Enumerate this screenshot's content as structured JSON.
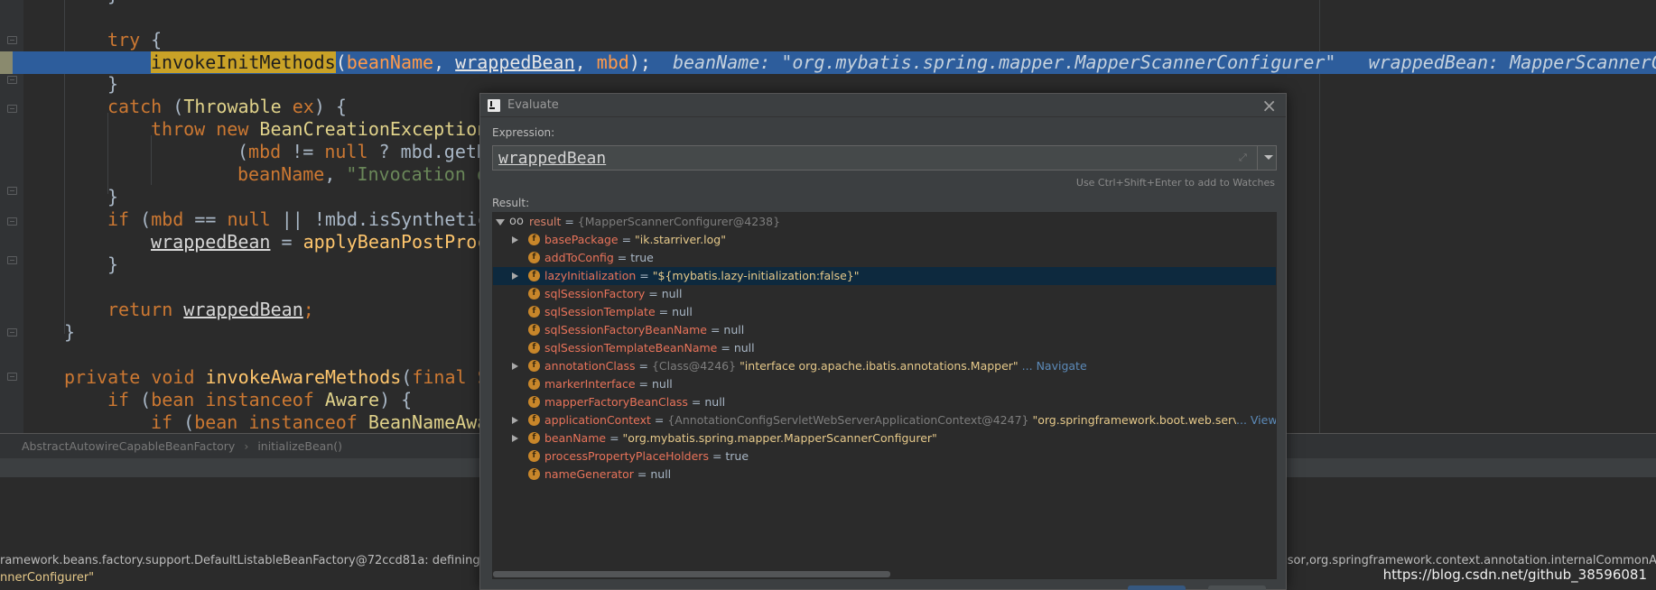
{
  "editor": {
    "lines": {
      "l0": "}",
      "l1_kw": "try",
      "l1_brace": " {",
      "l2_call": "invokeInitMethods",
      "l2_p1": "beanName",
      "l2_p2": "wrappedBean",
      "l2_p3": "mbd",
      "l2_inline": "beanName: \"org.mybatis.spring.mapper.MapperScannerConfigurer\"   wrappedBean: MapperScannerCo",
      "l3": "}",
      "l4_kw": "catch",
      "l4_cls": "Throwable",
      "l4_var": "ex",
      "l5_kw": "throw new",
      "l5_cls": "BeanCreationException",
      "l6_a": "mbd",
      "l6_b": "!= ",
      "l6_kw": "null",
      "l6_c": " ? ",
      "l6_d": "mbd.getR",
      "l7_a": "beanName",
      "l7_str": "\"Invocation o",
      "l8": "}",
      "l9_kw": "if",
      "l9_a": "mbd",
      "l9_kw2": "null",
      "l9_b": "!mbd.isSynthetic",
      "l10_a": "wrappedBean",
      "l10_fn": "applyBeanPostProc",
      "l11": "}",
      "l12_kw": "return",
      "l12_var": "wrappedBean",
      "l13": "}",
      "l14_kw": "private void",
      "l14_fn": "invokeAwareMethods",
      "l14_kw2": "final S",
      "l15_kw": "if",
      "l15_a": "bean",
      "l15_kw2": "instanceof",
      "l15_cls": "Aware",
      "l16_kw": "if",
      "l16_a": "bean",
      "l16_kw2": "instanceof",
      "l16_cls": "BeanNameAwa"
    }
  },
  "breadcrumb": {
    "class_name": "AbstractAutowireCapableBeanFactory",
    "separator": "›",
    "method": "initializeBean()"
  },
  "console": {
    "line1_left": "ramework.beans.factory.support.DefaultListableBeanFactory@72ccd81a: defining beans [org",
    "line1_right": "essor,org.springframework.context.annotation.internalCommonAnnotat",
    "line2": "nnerConfigurer\""
  },
  "dialog": {
    "title": "Evaluate",
    "close_glyph": "×",
    "expression_label": "Expression:",
    "expression_value": "wrappedBean",
    "hint": "Use Ctrl+Shift+Enter to add to Watches",
    "result_label": "Result:",
    "root": {
      "name": "result",
      "eq": " = ",
      "value": "{MapperScannerConfigurer@4238}"
    },
    "fields": [
      {
        "name": "basePackage",
        "eq": " = ",
        "value": "\"ik.starriver.log\""
      },
      {
        "name": "addToConfig",
        "eq": " = ",
        "value": "true"
      },
      {
        "name": "lazyInitialization",
        "eq": " = ",
        "value": "\"${mybatis.lazy-initialization:false}\""
      },
      {
        "name": "sqlSessionFactory",
        "eq": " = ",
        "value": "null"
      },
      {
        "name": "sqlSessionTemplate",
        "eq": " = ",
        "value": "null"
      },
      {
        "name": "sqlSessionFactoryBeanName",
        "eq": " = ",
        "value": "null"
      },
      {
        "name": "sqlSessionTemplateBeanName",
        "eq": " = ",
        "value": "null"
      },
      {
        "name": "annotationClass",
        "eq": " = ",
        "obj": "{Class@4246}",
        "value": "\"interface org.apache.ibatis.annotations.Mapper\"",
        "link": "... Navigate"
      },
      {
        "name": "markerInterface",
        "eq": " = ",
        "value": "null"
      },
      {
        "name": "mapperFactoryBeanClass",
        "eq": " = ",
        "value": "null"
      },
      {
        "name": "applicationContext",
        "eq": " = ",
        "obj": "{AnnotationConfigServletWebServerApplicationContext@4247}",
        "value": "\"org.springframework.boot.web.servlet.context",
        "link": "... View"
      },
      {
        "name": "beanName",
        "eq": " = ",
        "value": "\"org.mybatis.spring.mapper.MapperScannerConfigurer\""
      },
      {
        "name": "processPropertyPlaceHolders",
        "eq": " = ",
        "value": "true"
      },
      {
        "name": "nameGenerator",
        "eq": " = ",
        "value": "null"
      }
    ]
  },
  "icons": {
    "field": "f",
    "watch": "oo",
    "expand": "⤢"
  },
  "watermark": "https://blog.csdn.net/github_38596081"
}
